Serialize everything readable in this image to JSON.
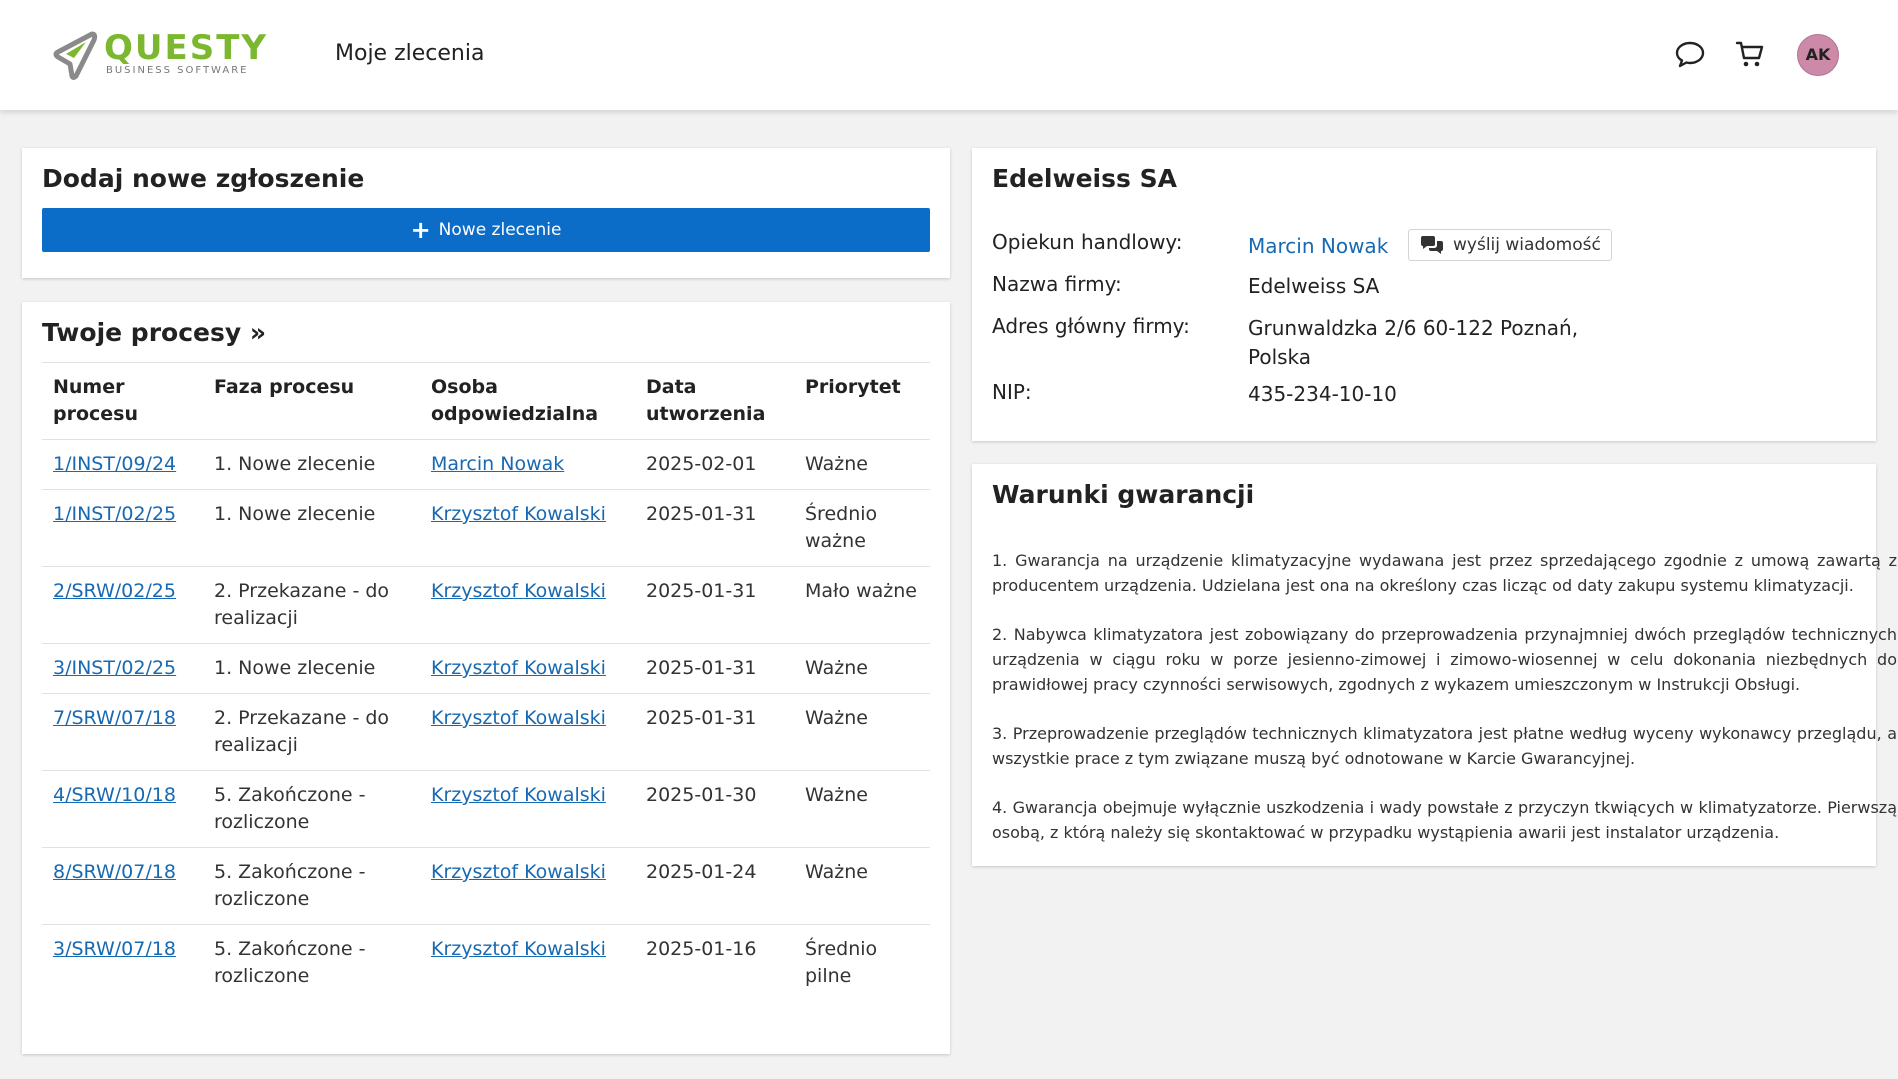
{
  "app": {
    "logo_word": "QUESTY",
    "logo_sub": "BUSINESS SOFTWARE",
    "page_title": "Moje zlecenia",
    "user_initials": "AK"
  },
  "new_request": {
    "title": "Dodaj nowe zgłoszenie",
    "button_label": "Nowe zlecenie"
  },
  "processes": {
    "title": "Twoje procesy »",
    "columns": [
      "Numer procesu",
      "Faza procesu",
      "Osoba odpowiedzialna",
      "Data utworzenia",
      "Priorytet"
    ],
    "rows": [
      {
        "number": "1/INST/09/24",
        "phase": "1. Nowe zlecenie",
        "person": "Marcin Nowak",
        "date": "2025-02-01",
        "priority": "Ważne"
      },
      {
        "number": "1/INST/02/25",
        "phase": "1. Nowe zlecenie",
        "person": "Krzysztof Kowalski",
        "date": "2025-01-31",
        "priority": "Średnio ważne"
      },
      {
        "number": "2/SRW/02/25",
        "phase": "2. Przekazane - do realizacji",
        "person": "Krzysztof Kowalski",
        "date": "2025-01-31",
        "priority": "Mało ważne"
      },
      {
        "number": "3/INST/02/25",
        "phase": "1. Nowe zlecenie",
        "person": "Krzysztof Kowalski",
        "date": "2025-01-31",
        "priority": "Ważne"
      },
      {
        "number": "7/SRW/07/18",
        "phase": "2. Przekazane - do realizacji",
        "person": "Krzysztof Kowalski",
        "date": "2025-01-31",
        "priority": "Ważne"
      },
      {
        "number": "4/SRW/10/18",
        "phase": "5. Zakończone - rozliczone",
        "person": "Krzysztof Kowalski",
        "date": "2025-01-30",
        "priority": "Ważne"
      },
      {
        "number": "8/SRW/07/18",
        "phase": "5. Zakończone - rozliczone",
        "person": "Krzysztof Kowalski",
        "date": "2025-01-24",
        "priority": "Ważne"
      },
      {
        "number": "3/SRW/07/18",
        "phase": "5. Zakończone - rozliczone",
        "person": "Krzysztof Kowalski",
        "date": "2025-01-16",
        "priority": "Średnio pilne"
      }
    ]
  },
  "company": {
    "title": "Edelweiss SA",
    "account_manager_label": "Opiekun handlowy:",
    "account_manager_name": "Marcin Nowak",
    "send_message_label": "wyślij wiadomość",
    "name_label": "Nazwa firmy:",
    "name_value": "Edelweiss SA",
    "address_label": "Adres główny firmy:",
    "address_value": "Grunwaldzka 2/6 60-122 Poznań, Polska",
    "nip_label": "NIP:",
    "nip_value": "435-234-10-10"
  },
  "warranty": {
    "title": "Warunki gwarancji",
    "paragraphs": [
      "1. Gwarancja na urządzenie klimatyzacyjne wydawana jest przez sprzedającego zgodnie z umową zawartą z producentem urządzenia. Udzielana jest ona na określony czas licząc od daty zakupu systemu klimatyzacji.",
      "2. Nabywca klimatyzatora jest zobowiązany do przeprowadzenia przynajmniej dwóch przeglądów technicznych urządzenia w ciągu roku w porze jesienno-zimowej i zimowo-wiosennej w celu dokonania niezbędnych do prawidłowej pracy czynności serwisowych, zgodnych z wykazem umieszczonym w Instrukcji Obsługi.",
      "3. Przeprowadzenie przeglądów technicznych klimatyzatora jest płatne według wyceny wykonawcy przeglądu, a wszystkie prace z tym związane muszą być odnotowane w Karcie Gwarancyjnej.",
      "4. Gwarancja obejmuje wyłącznie uszkodzenia i wady powstałe z przyczyn tkwiących w klimatyzatorze. Pierwszą osobą, z którą należy się skontaktować w przypadku wystąpienia awarii jest instalator urządzenia."
    ]
  },
  "colors": {
    "brand_green": "#7cb82f",
    "primary_blue": "#0b6dc8",
    "link_blue": "#1769b3",
    "avatar_pink": "#cc8aa8"
  }
}
